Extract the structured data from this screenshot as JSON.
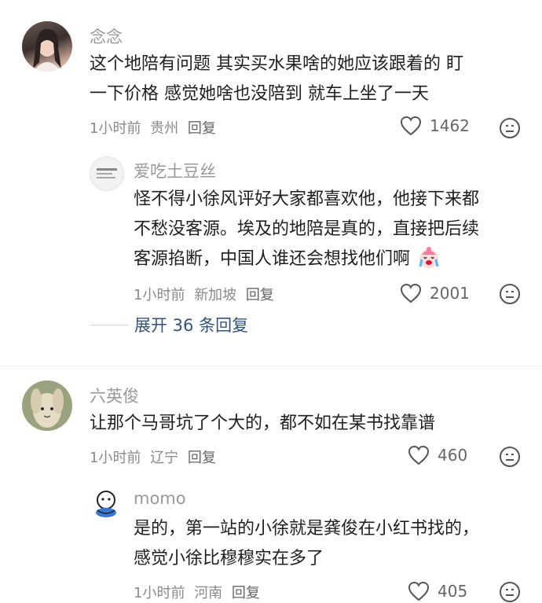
{
  "comments": [
    {
      "author": "念念",
      "lines": [
        "这个地陪有问题  其实买水果啥的她应该跟着的  盯",
        "一下价格  感觉她啥也没陪到 就车上坐了一天"
      ],
      "time": "1小时前",
      "location": "贵州",
      "reply_label": "回复",
      "likes": "1462",
      "replies": [
        {
          "author": "爱吃土豆丝",
          "lines": [
            "怪不得小徐风评好大家都喜欢他，他接下来都",
            "不愁没客源。埃及的地陪是真的，直接把后续",
            "客源掐断，中国人谁还会想找他们啊"
          ],
          "emoji": "😭",
          "time": "1小时前",
          "location": "新加坡",
          "reply_label": "回复",
          "likes": "2001"
        }
      ],
      "expand_label": "展开 36 条回复"
    },
    {
      "author": "六英俊",
      "lines": [
        "让那个马哥坑了个大的，都不如在某书找靠谱"
      ],
      "time": "1小时前",
      "location": "辽宁",
      "reply_label": "回复",
      "likes": "460",
      "replies": [
        {
          "author": "momo",
          "lines": [
            "是的，第一站的小徐就是龚俊在小红书找的，",
            "感觉小徐比穆穆实在多了"
          ],
          "time": "1小时前",
          "location": "河南",
          "reply_label": "回复",
          "likes": "405"
        }
      ]
    }
  ],
  "colors": {
    "accent_link": "#32547a",
    "meta_gray": "#8a8a8a",
    "name_gray": "#999999"
  },
  "icons": {
    "like": "heart-outline-icon",
    "dislike": "unhappy-face-icon"
  }
}
